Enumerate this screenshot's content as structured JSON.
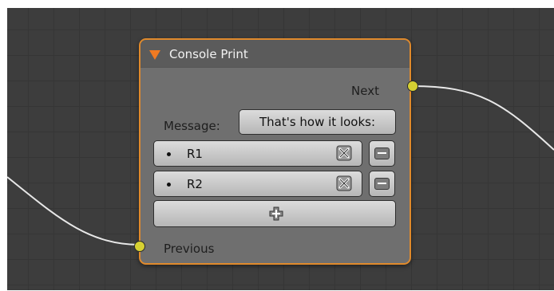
{
  "node": {
    "title": "Console Print",
    "output_socket_label": "Next",
    "input_socket_label": "Previous",
    "message_label": "Message:",
    "message_value": "That's how it looks:",
    "items": [
      {
        "label": "R1"
      },
      {
        "label": "R2"
      }
    ]
  },
  "colors": {
    "node_border": "#e08a2c",
    "collapse_arrow": "#f07a22",
    "socket": "#d6d032",
    "grid_background": "#3d3d3d",
    "node_body": "#6f6f6f"
  },
  "icons": {
    "collapse": "triangle-down-icon",
    "socket": "socket-dot-icon",
    "remove": "x-box-icon",
    "delete_row": "minus-icon",
    "add": "plus-icon"
  }
}
